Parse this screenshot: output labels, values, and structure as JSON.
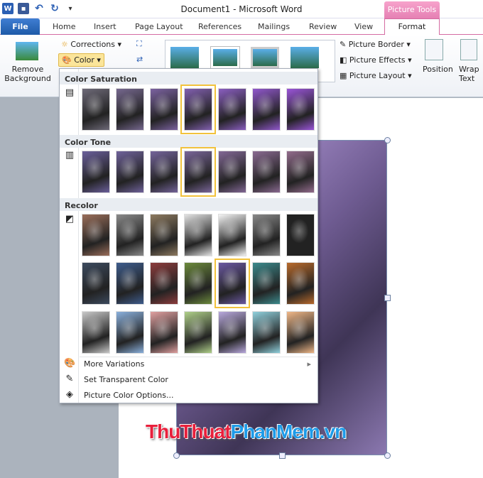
{
  "title": "Document1  -  Microsoft Word",
  "contextual_tab": "Picture Tools",
  "tabs": [
    "Home",
    "Insert",
    "Page Layout",
    "References",
    "Mailings",
    "Review",
    "View"
  ],
  "file_tab": "File",
  "active_tab": "Format",
  "ribbon": {
    "remove_background": "Remove Background",
    "corrections": "Corrections",
    "color": "Color",
    "picture_border": "Picture Border",
    "picture_effects": "Picture Effects",
    "picture_layout": "Picture Layout",
    "position": "Position",
    "wrap_text": "Wrap Text"
  },
  "menu": {
    "sections": [
      "Color Saturation",
      "Color Tone",
      "Recolor"
    ],
    "saturation": [
      "#6e6a78",
      "#76688f",
      "#7b62a0",
      "#8260b0",
      "#8a5ec0",
      "#9158cc",
      "#9a55d8"
    ],
    "tone": [
      "#6a5f9a",
      "#6f629a",
      "#74649a",
      "#7a6699",
      "#826895",
      "#8a6a91",
      "#926c8c"
    ],
    "recolor": [
      [
        "#9a6e5a",
        "#8a8a8a",
        "#8d7a60",
        "#e2e2e2",
        "#f4f4f4",
        "#888888",
        "#222222"
      ],
      [
        "#3c4a5e",
        "#3e5c8c",
        "#8c3c3c",
        "#6c8a3c",
        "#6a58a0",
        "#3c8a8c",
        "#b86a2c"
      ],
      [
        "#c8c8c8",
        "#8ab0dc",
        "#e0a0a0",
        "#b0d08a",
        "#b8a8dc",
        "#90d0dc",
        "#f0b888"
      ]
    ],
    "selected": {
      "saturation": 3,
      "tone": 3,
      "recolor_row": 1,
      "recolor_col": 4
    },
    "items": [
      "More Variations",
      "Set Transparent Color",
      "Picture Color Options..."
    ]
  },
  "watermark": {
    "part1": "ThuThuat",
    "part2": "PhanMem.vn",
    "color1": "#e8203c",
    "color2": "#1e9be8"
  }
}
